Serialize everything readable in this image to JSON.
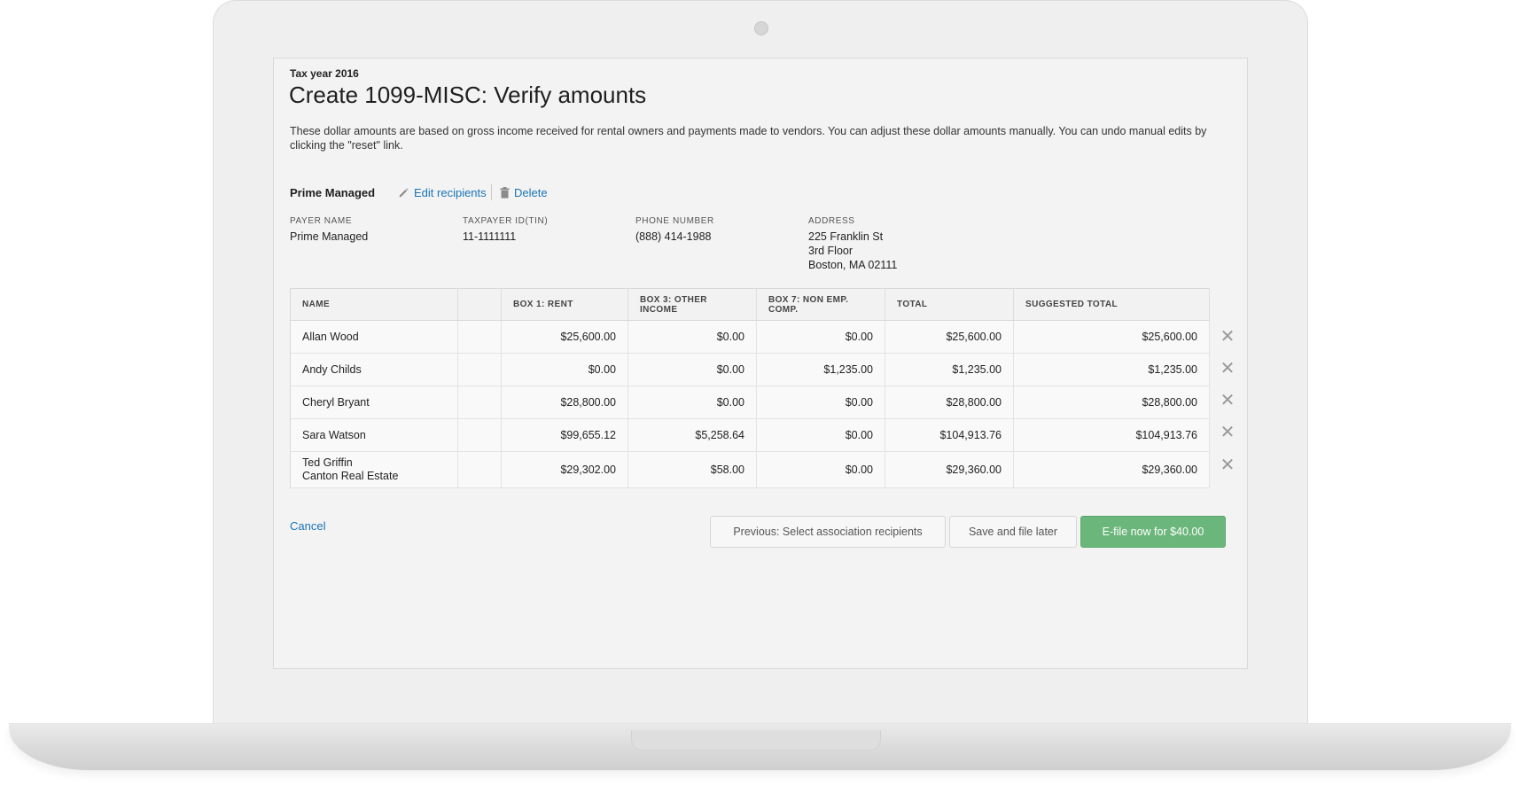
{
  "colors": {
    "link": "#1a74b8",
    "primary_button": "#6bb67a",
    "screen_bg": "#f3f3f3"
  },
  "page": {
    "tax_year": "Tax year 2016",
    "title": "Create 1099-MISC: Verify amounts",
    "description": "These dollar amounts are based on gross income received for rental owners and payments made to vendors. You can adjust these dollar amounts manually. You can undo manual edits by clicking the \"reset\" link."
  },
  "payer": {
    "heading": "Prime Managed",
    "edit_label": "Edit recipients",
    "edit_icon": "pencil-icon",
    "delete_label": "Delete",
    "delete_icon": "trash-icon",
    "fields": {
      "payer_name_label": "PAYER NAME",
      "payer_name": "Prime Managed",
      "tin_label": "TAXPAYER ID(TIN)",
      "tin": "11-1111111",
      "phone_label": "PHONE NUMBER",
      "phone": "(888) 414-1988",
      "address_label": "ADDRESS",
      "address_line1": "225 Franklin St",
      "address_line2": "3rd Floor",
      "address_line3": "Boston, MA 02111"
    }
  },
  "table": {
    "headers": {
      "name": "NAME",
      "blank": "",
      "box1": "BOX 1: RENT",
      "box3": "BOX 3: OTHER INCOME",
      "box7": "BOX 7: NON EMP. COMP.",
      "total": "TOTAL",
      "suggested": "SUGGESTED TOTAL"
    },
    "rows": [
      {
        "name": "Allan Wood",
        "name2": "",
        "box1": "$25,600.00",
        "box3": "$0.00",
        "box7": "$0.00",
        "total": "$25,600.00",
        "suggested": "$25,600.00"
      },
      {
        "name": "Andy Childs",
        "name2": "",
        "box1": "$0.00",
        "box3": "$0.00",
        "box7": "$1,235.00",
        "total": "$1,235.00",
        "suggested": "$1,235.00"
      },
      {
        "name": "Cheryl Bryant",
        "name2": "",
        "box1": "$28,800.00",
        "box3": "$0.00",
        "box7": "$0.00",
        "total": "$28,800.00",
        "suggested": "$28,800.00"
      },
      {
        "name": "Sara Watson",
        "name2": "",
        "box1": "$99,655.12",
        "box3": "$5,258.64",
        "box7": "$0.00",
        "total": "$104,913.76",
        "suggested": "$104,913.76"
      },
      {
        "name": "Ted Griffin",
        "name2": "Canton Real Estate",
        "box1": "$29,302.00",
        "box3": "$58.00",
        "box7": "$0.00",
        "total": "$29,360.00",
        "suggested": "$29,360.00"
      }
    ],
    "remove_icon": "close-icon"
  },
  "footer": {
    "cancel": "Cancel",
    "previous": "Previous: Select association recipients",
    "save": "Save and file later",
    "efile": "E-file now for $40.00"
  }
}
